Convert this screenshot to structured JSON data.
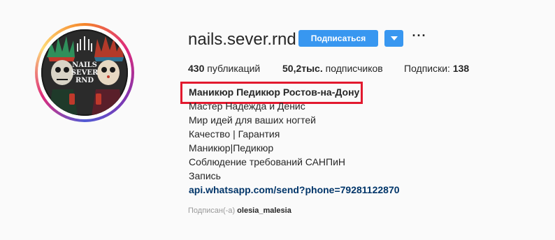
{
  "profile": {
    "username": "nails.sever.rnd",
    "avatar_text": [
      "NAILS",
      "SEVER",
      "RND"
    ]
  },
  "actions": {
    "follow_label": "Подписаться",
    "dropdown_icon": "chevron-down-icon",
    "more_label": "···"
  },
  "stats": {
    "posts_count": "430",
    "posts_label": "публикаций",
    "followers_count": "50,2тыс.",
    "followers_label": "подписчиков",
    "following_label": "Подписки:",
    "following_count": "138"
  },
  "bio": {
    "full_name": "Маникюр Педикюр Ростов-на-Дону",
    "lines": [
      "Мастер Надежда и Денис",
      "Мир идей для ваших ногтей",
      "Качество | Гарантия",
      " Маникюр|Педикюр",
      "Соблюдение требований САНПиН",
      "Запись  "
    ],
    "link": "api.whatsapp.com/send?phone=79281122870"
  },
  "followed_by": {
    "prefix": "Подписан(-а)",
    "user": "olesia_malesia"
  },
  "colors": {
    "accent": "#3897f0",
    "highlight": "#e2192e",
    "link": "#003569"
  }
}
